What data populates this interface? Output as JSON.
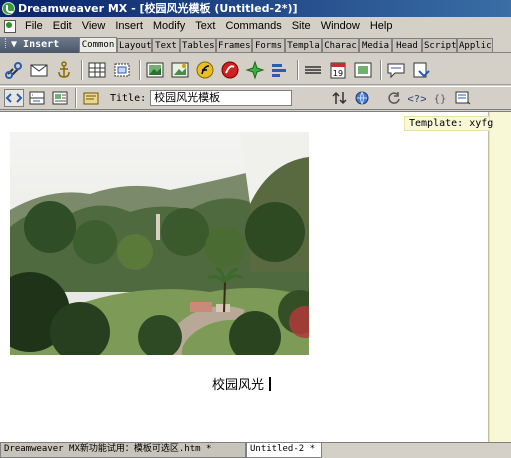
{
  "window": {
    "title": "Dreamweaver MX - [校园风光模板 (Untitled-2*)]"
  },
  "menubar": {
    "items": [
      "File",
      "Edit",
      "View",
      "Insert",
      "Modify",
      "Text",
      "Commands",
      "Site",
      "Window",
      "Help"
    ]
  },
  "insert_panel": {
    "title": "Insert",
    "tabs": [
      "Common",
      "Layout",
      "Text",
      "Tables",
      "Frames",
      "Forms",
      "Templa",
      "Charac",
      "Media",
      "Head",
      "Script",
      "Applic"
    ],
    "active_tab": "Common"
  },
  "doc_toolbar": {
    "title_label": "Title:",
    "title_value": "校园风光模板"
  },
  "document": {
    "template_tag": "Template: xyfg",
    "caption": "校园风光"
  },
  "doc_tabs": [
    {
      "label": "Dreamweaver MX新功能试用：模板可选区.htm *",
      "active": false
    },
    {
      "label": "Untitled-2 *",
      "active": true
    }
  ],
  "colors": {
    "titlebar_start": "#0a246a",
    "titlebar_end": "#3a6ea5",
    "template_bg": "#f8f7d6"
  }
}
